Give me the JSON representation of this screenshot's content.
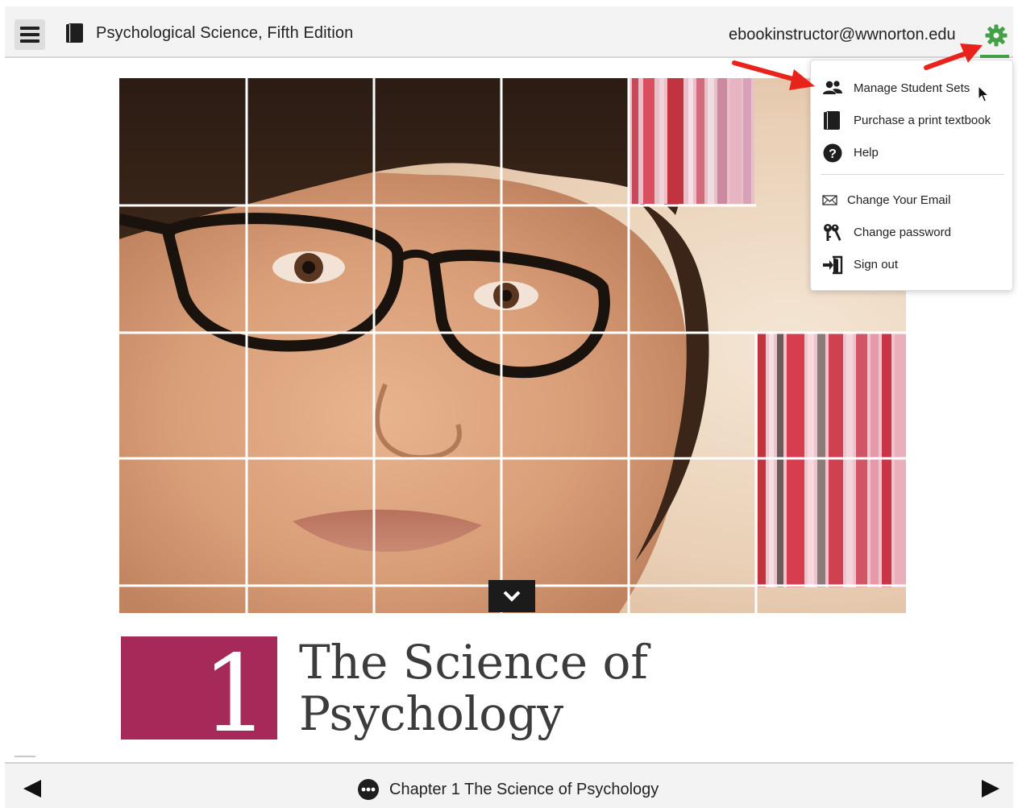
{
  "header": {
    "book_title": "Psychological Science, Fifth Edition",
    "user_email": "ebookinstructor@wwnorton.edu"
  },
  "settings_menu": {
    "items": [
      {
        "label": "Manage Student Sets",
        "icon": "users-icon"
      },
      {
        "label": "Purchase a print textbook",
        "icon": "book-icon"
      },
      {
        "label": "Help",
        "icon": "question-circle-icon"
      },
      {
        "label": "Change Your Email",
        "icon": "envelope-icon"
      },
      {
        "label": "Change password",
        "icon": "keys-icon"
      },
      {
        "label": "Sign out",
        "icon": "sign-out-icon"
      }
    ]
  },
  "chapter": {
    "number": "1",
    "title_line1": "The Science of",
    "title_line2": "Psychology"
  },
  "footer": {
    "chapter_label": "Chapter 1 The Science of Psychology"
  },
  "colors": {
    "chapter_accent": "#a52a5a",
    "gear_green": "#43a047",
    "annotation_red": "#e8231b"
  }
}
